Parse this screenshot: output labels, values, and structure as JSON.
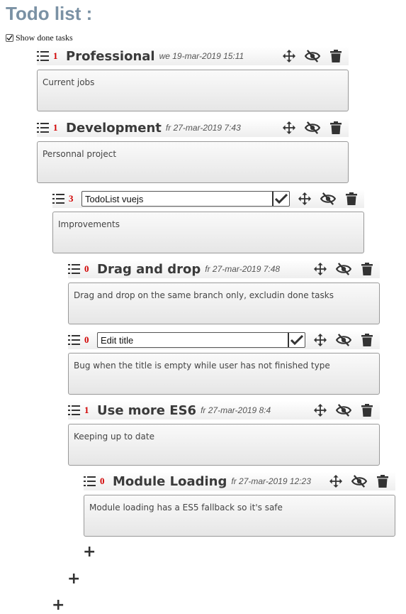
{
  "page": {
    "title": "Todo list :",
    "show_done_label": "Show done tasks",
    "show_done_checked": true,
    "add_label": "+"
  },
  "tasks": [
    {
      "count": "1",
      "title": "Professional",
      "date": "we 19-mar-2019 15:11",
      "description": "Current jobs",
      "editing": false
    },
    {
      "count": "1",
      "title": "Development",
      "date": "fr 27-mar-2019 7:43",
      "description": "Personnal project",
      "editing": false
    },
    {
      "count": "3",
      "title": "TodoList vuejs",
      "date": "",
      "description": "Improvements",
      "editing": true
    },
    {
      "count": "0",
      "title": "Drag and drop",
      "date": "fr 27-mar-2019 7:48",
      "description": "Drag and drop on the same branch only, excludin done tasks",
      "editing": false
    },
    {
      "count": "0",
      "title": "Edit title",
      "date": "",
      "description": "Bug when the title is empty while user has not finished type",
      "editing": true
    },
    {
      "count": "1",
      "title": "Use more ES6",
      "date": "fr 27-mar-2019 8:4",
      "description": "Keeping up to date",
      "editing": false
    },
    {
      "count": "0",
      "title": "Module Loading",
      "date": "fr 27-mar-2019 12:23",
      "description": "Module loading has a ES5 fallback so it's safe",
      "editing": false
    }
  ],
  "icons": {
    "list": "list-icon",
    "move": "move-arrows-icon",
    "hide": "eye-slash-icon",
    "delete": "trash-icon",
    "confirm": "checkmark-icon",
    "add": "plus-icon"
  }
}
